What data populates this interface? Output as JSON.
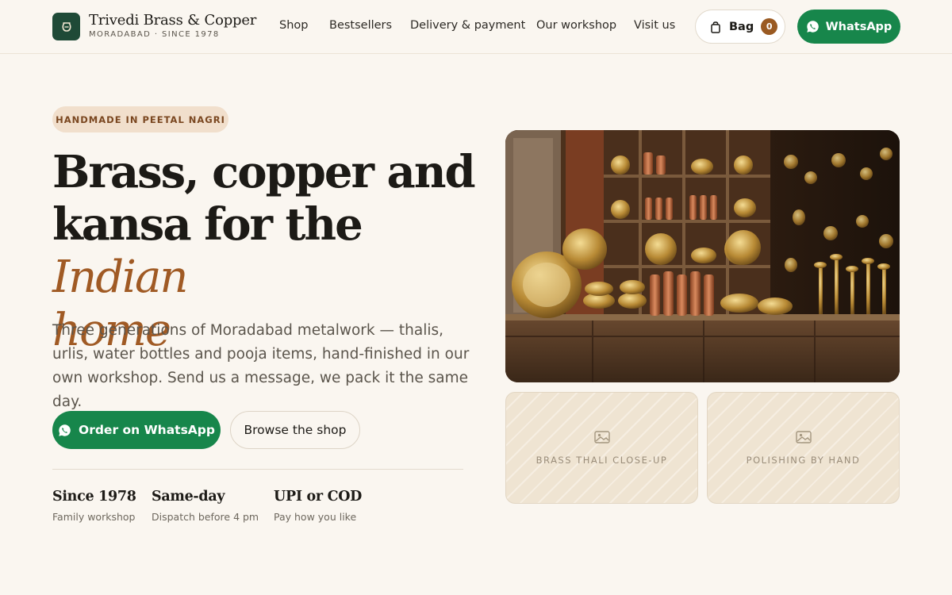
{
  "brand": {
    "name": "Trivedi Brass & Copper",
    "tagline": "MORADABAD · SINCE 1978",
    "logo_icon": "pot-icon"
  },
  "nav": {
    "items": [
      {
        "label": "Shop"
      },
      {
        "label": "Bestsellers"
      },
      {
        "label": "Delivery & payment"
      },
      {
        "label": "Our workshop"
      },
      {
        "label": "Visit us"
      }
    ],
    "bag": {
      "label": "Bag",
      "count": "0",
      "icon": "shopping-bag-icon"
    },
    "whatsapp": {
      "label": "WhatsApp",
      "icon": "whatsapp-icon"
    }
  },
  "hero": {
    "eyebrow": "HANDMADE IN PEETAL NAGRI",
    "title_line1": "Brass, copper and",
    "title_line2_plain": "kansa for the ",
    "title_line2_accent": "Indian",
    "title_line3_accent": "home",
    "copy": "Three generations of Moradabad metalwork — thalis, urlis, water bottles and pooja items, hand-finished in our own workshop. Send us a message, we pack it the same day.",
    "cta_primary": "Order on WhatsApp",
    "cta_secondary": "Browse the shop",
    "stats": [
      {
        "title": "Since 1978",
        "sub": "Family workshop"
      },
      {
        "title": "Same-day",
        "sub": "Dispatch before 4 pm"
      },
      {
        "title": "UPI or COD",
        "sub": "Pay how you like"
      }
    ]
  },
  "gallery": {
    "placeholders": [
      {
        "label": "BRASS THALI CLOSE-UP",
        "icon": "image-icon"
      },
      {
        "label": "POLISHING BY HAND",
        "icon": "image-icon"
      }
    ]
  },
  "colors": {
    "background": "#faf6f0",
    "brand_green": "#17864b",
    "accent_copper": "#a05a24",
    "logo_green": "#1f4a37"
  }
}
